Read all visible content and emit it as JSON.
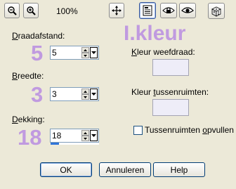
{
  "toolbar": {
    "zoom_level": "100%",
    "buttons": [
      {
        "icon": "zoom-out-icon"
      },
      {
        "icon": "zoom-in-icon"
      },
      {
        "icon": "pan-icon"
      },
      {
        "icon": "proof-icon"
      },
      {
        "icon": "lock-icon"
      },
      {
        "icon": "eye-icon"
      },
      {
        "icon": "randomize-dice-icon"
      }
    ]
  },
  "brand_text": "I.kleur",
  "fields": {
    "draadafstand": {
      "label_prefix": "D",
      "label_rest": "raadafstand:",
      "value": "5",
      "annotation": "5"
    },
    "breedte": {
      "label_prefix": "B",
      "label_rest": "reedte:",
      "value": "3",
      "annotation": "3"
    },
    "dekking": {
      "label_prefix": "D",
      "label_rest": "ekking:",
      "value": "18",
      "annotation": "18",
      "progress_fraction": 0.18
    }
  },
  "colors": {
    "weefdraad": {
      "label_prefix": "K",
      "label_rest": "leur weefdraad:",
      "swatch": "#eeedf8"
    },
    "tussenruimten": {
      "label_a": "Kleur ",
      "label_u": "t",
      "label_b": "ussenruimten:",
      "swatch": "#eeedf8"
    }
  },
  "checkbox": {
    "label_a": "Tussenruimten ",
    "label_u": "o",
    "label_b": "pvullen",
    "checked": false
  },
  "buttons": {
    "ok": "OK",
    "cancel": "Annuleren",
    "help": "Help"
  },
  "accent_colors": {
    "annotation": "#c09ae0",
    "border": "#003c74",
    "progress": "#2e74d9"
  }
}
